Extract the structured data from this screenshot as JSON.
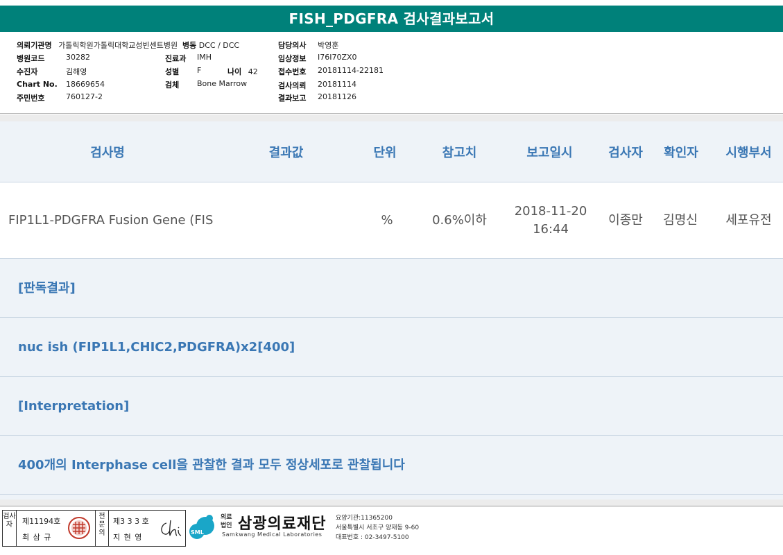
{
  "title": "FISH_PDGFRA 검사결과보고서",
  "patient": {
    "institution_label": "의뢰기관명",
    "institution_value": "가톨릭학원가톨릭대학교성빈센트병원",
    "ward_label": "병동",
    "ward_value": "DCC / DCC",
    "doctor_label": "담당의사",
    "doctor_value": "박영훈",
    "hospital_code_label": "병원코드",
    "hospital_code_value": "30282",
    "dept_label": "진료과",
    "dept_value": "IMH",
    "clinical_info_label": "임상정보",
    "clinical_info_value": "I76I70ZX0",
    "patient_label": "수진자",
    "patient_value": "김해영",
    "sex_label": "성별",
    "sex_value": "F",
    "age_label": "나이",
    "age_value": "42",
    "receipt_label": "접수번호",
    "receipt_value": "20181114-22181",
    "chart_label": "Chart No.",
    "chart_value": "18669654",
    "specimen_label": "검체",
    "specimen_value": "Bone Marrow",
    "request_label": "검사의뢰",
    "request_value": "20181114",
    "id_label": "주민번호",
    "id_value": "760127-2",
    "report_label": "결과보고",
    "report_value": "20181126"
  },
  "table": {
    "headers": {
      "test_name": "검사명",
      "result": "결과값",
      "unit": "단위",
      "reference": "참고치",
      "report_datetime": "보고일시",
      "tester": "검사자",
      "confirmer": "확인자",
      "department": "시행부서"
    },
    "row": {
      "test_name": "FIP1L1-PDGFRA Fusion Gene (FIS",
      "result": "",
      "unit": "%",
      "reference": "0.6%이하",
      "report_datetime": "2018-11-20 16:44",
      "tester": "이종만",
      "confirmer": "김명신",
      "department": "세포유전"
    }
  },
  "sections": [
    "[판독결과]",
    "nuc ish (FIP1L1,CHIC2,PDGFRA)x2[400]",
    "[Interpretation]",
    "400개의 Interphase cell을 관찰한 결과  모두 정상세포로 관찰됩니다"
  ],
  "footer": {
    "tester_label": "검사자",
    "tester_license": "제11194호",
    "tester_name": "최 삼 규",
    "specialist_label": "전문의",
    "specialist_license": "제3 3 3 호",
    "specialist_name": "지 현 영",
    "org_prefix_1": "의료",
    "org_prefix_2": "법인",
    "org_name": "삼광의료재단",
    "org_english": "Samkwang Medical Laboratories",
    "logo_text": "SML",
    "org_code": "요양기관:11365200",
    "org_address": "서울특별시 서초구 양재동 9-60",
    "org_phone": "대표번호 : 02-3497-5100"
  },
  "colors": {
    "title_bg": "#00817a",
    "header_text": "#3a77b4",
    "results_bg": "#eef3f8",
    "logo": "#1aa6c8"
  }
}
